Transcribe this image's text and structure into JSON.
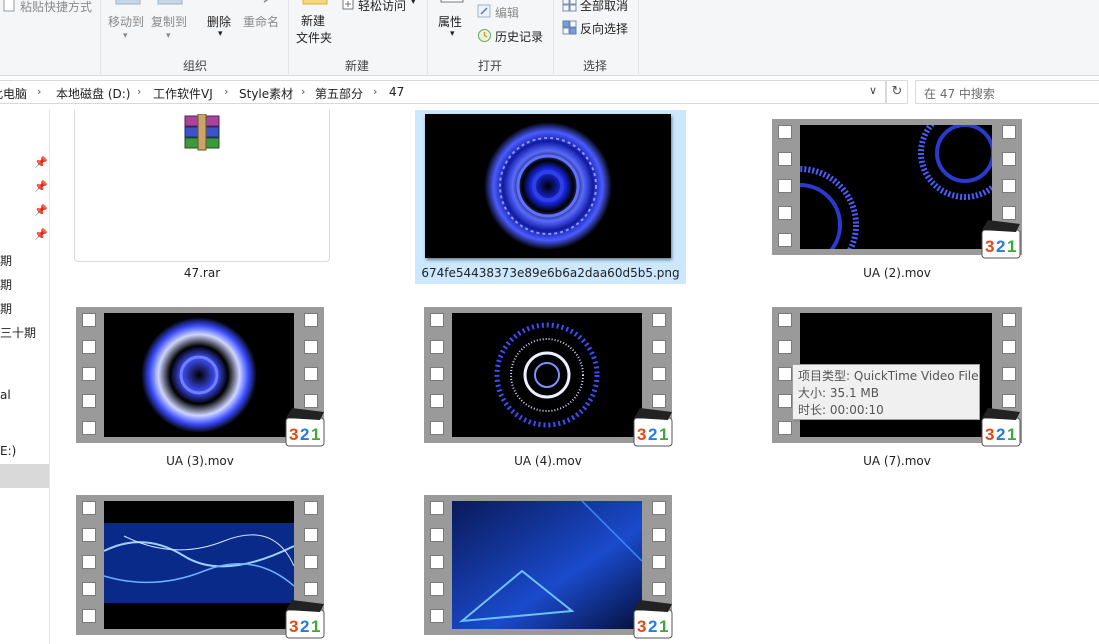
{
  "ribbon": {
    "paste_shortcut": "粘贴快捷方式",
    "move_to": "移动到",
    "copy_to": "复制到",
    "delete": "删除",
    "rename": "重命名",
    "new_folder_line1": "新建",
    "new_folder_line2": "文件夹",
    "easy_access": "轻松访问",
    "properties": "属性",
    "edit": "编辑",
    "history": "历史记录",
    "select_none": "全部取消",
    "invert_selection": "反向选择",
    "groups": {
      "organize": "组织",
      "new": "新建",
      "open": "打开",
      "select": "选择"
    }
  },
  "address": {
    "crumbs": [
      "此电脑",
      "本地磁盘 (D:)",
      "工作软件VJ",
      "Style素材",
      "第五部分",
      "47"
    ],
    "search_placeholder": "在 47 中搜索"
  },
  "nav": {
    "items": [
      "期",
      "期",
      "期",
      "三十期",
      "al",
      "E:)"
    ]
  },
  "files": [
    {
      "name": "47.rar",
      "type": "rar"
    },
    {
      "name": "674fe54438373e89e6b6a2daa60d5b5.png",
      "type": "png",
      "selected": true
    },
    {
      "name": "UA (2).mov",
      "type": "mov"
    },
    {
      "name": "UA (3).mov",
      "type": "mov"
    },
    {
      "name": "UA (4).mov",
      "type": "mov"
    },
    {
      "name": "UA (7).mov",
      "type": "mov"
    },
    {
      "name": "",
      "type": "mov"
    },
    {
      "name": "",
      "type": "mov"
    }
  ],
  "tooltip": {
    "type_label": "项目类型:",
    "type_value": "QuickTime Video File",
    "size_label": "大小:",
    "size_value": "35.1 MB",
    "duration_label": "时长:",
    "duration_value": "00:00:10"
  },
  "colors": {
    "selection": "#cce8ff",
    "ribbon_bg": "#f5f6f7",
    "accent_blue": "#3a4dff"
  }
}
